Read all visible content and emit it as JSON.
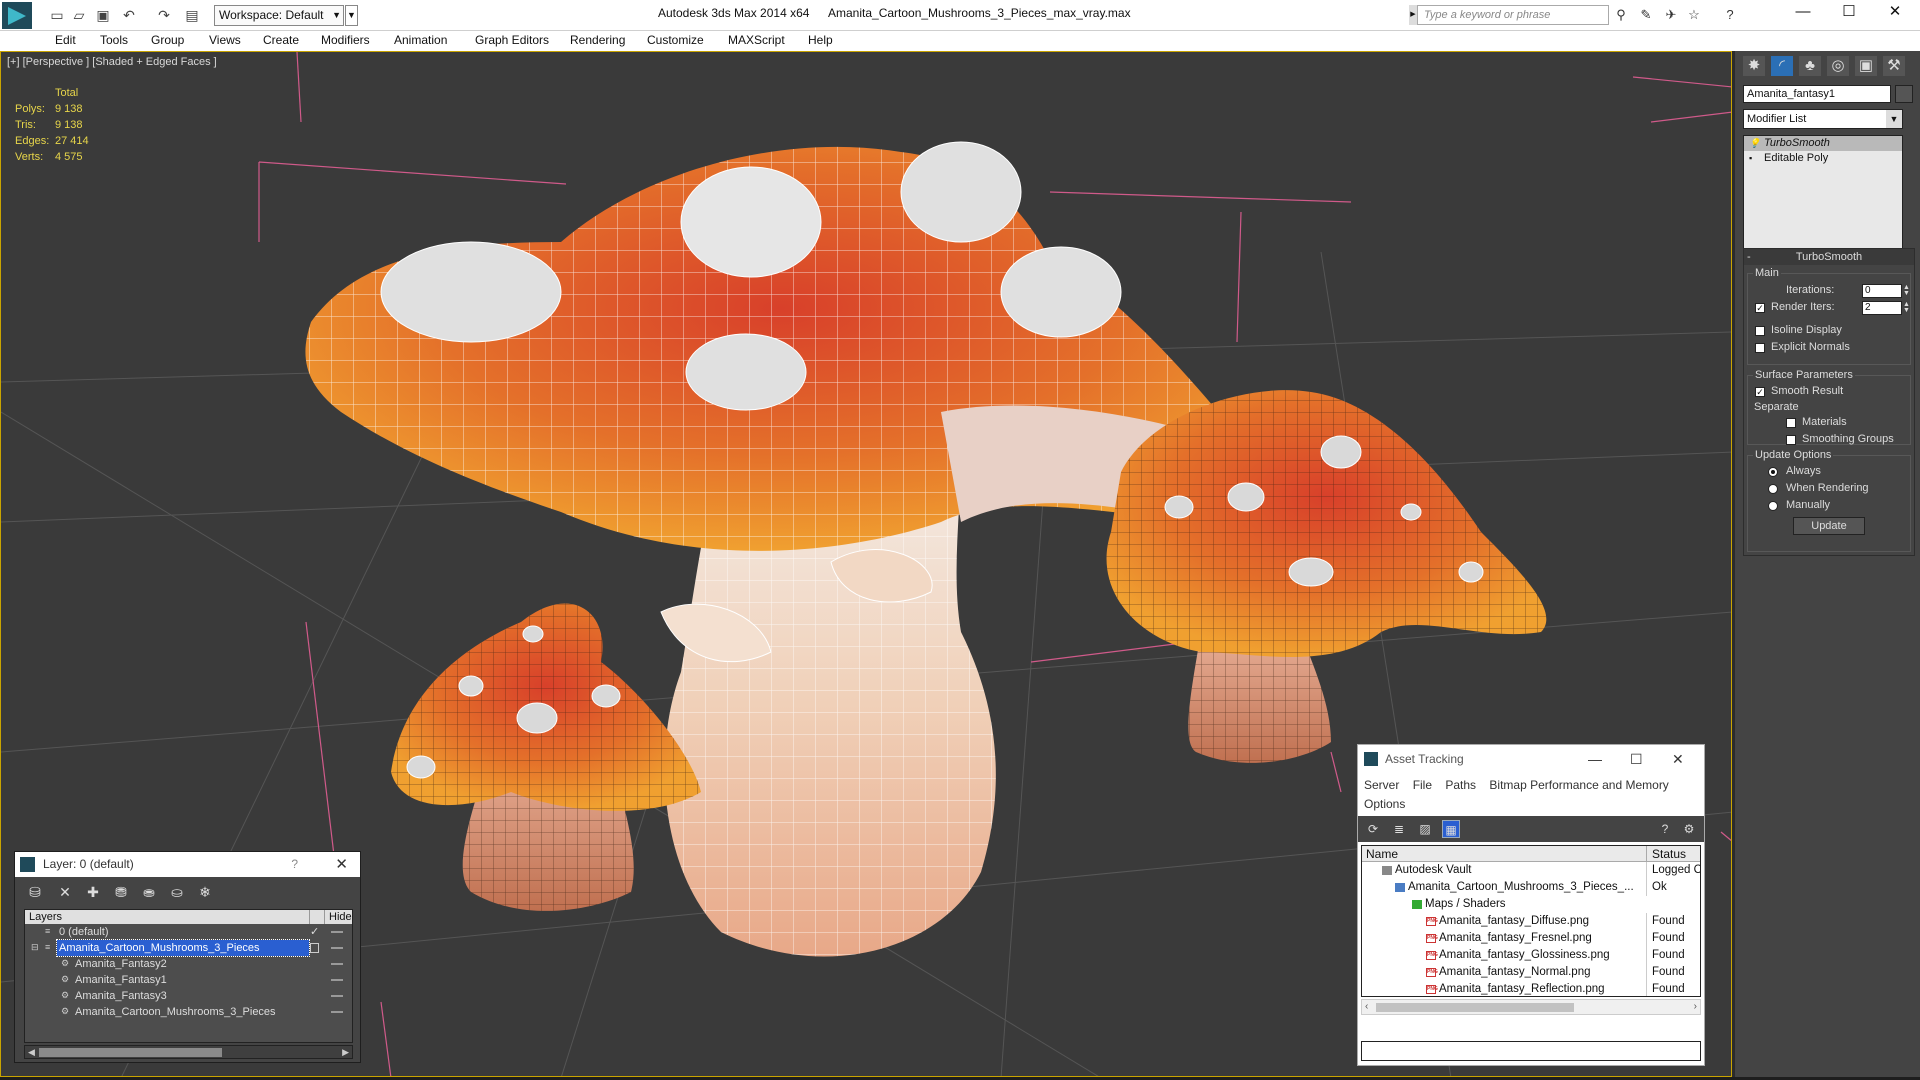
{
  "window": {
    "app_title": "Autodesk 3ds Max  2014 x64",
    "file_title": "Amanita_Cartoon_Mushrooms_3_Pieces_max_vray.max",
    "workspace": "Workspace: Default",
    "search_placeholder": "Type a keyword or phrase",
    "minimize": "—",
    "maximize": "☐",
    "close": "✕"
  },
  "menu": [
    "Edit",
    "Tools",
    "Group",
    "Views",
    "Create",
    "Modifiers",
    "Animation",
    "Graph Editors",
    "Rendering",
    "Customize",
    "MAXScript",
    "Help"
  ],
  "viewport": {
    "label": "[+] [Perspective ] [Shaded + Edged Faces ]",
    "stats": {
      "header": "Total",
      "rows": [
        {
          "k": "Polys:",
          "v": "9 138"
        },
        {
          "k": "Tris:",
          "v": "9 138"
        },
        {
          "k": "Edges:",
          "v": "27 414"
        },
        {
          "k": "Verts:",
          "v": "4 575"
        }
      ]
    }
  },
  "command_panel": {
    "object_name": "Amanita_fantasy1",
    "modifier_list": "Modifier List",
    "stack": [
      "TurboSmooth",
      "Editable Poly"
    ],
    "turbosmooth": {
      "title": "TurboSmooth",
      "main": "Main",
      "iterations_label": "Iterations:",
      "iterations_value": "0",
      "render_iters_label": "Render Iters:",
      "render_iters_value": "2",
      "isoline": "Isoline Display",
      "explicit": "Explicit Normals",
      "surface_params": "Surface Parameters",
      "smooth_result": "Smooth Result",
      "separate": "Separate",
      "materials": "Materials",
      "smoothing_groups": "Smoothing Groups",
      "update_options": "Update Options",
      "always": "Always",
      "when_rendering": "When Rendering",
      "manually": "Manually",
      "update_btn": "Update"
    }
  },
  "layer_window": {
    "title": "Layer: 0 (default)",
    "help": "?",
    "col_layers": "Layers",
    "col_hide": "Hide",
    "rows": [
      "0 (default)",
      "Amanita_Cartoon_Mushrooms_3_Pieces",
      "Amanita_Fantasy2",
      "Amanita_Fantasy1",
      "Amanita_Fantasy3",
      "Amanita_Cartoon_Mushrooms_3_Pieces"
    ]
  },
  "asset_window": {
    "title": "Asset Tracking",
    "menu": [
      "Server",
      "File",
      "Paths",
      "Bitmap Performance and Memory",
      "Options"
    ],
    "col_name": "Name",
    "col_status": "Status",
    "rows": [
      {
        "name": "Autodesk Vault",
        "status": "Logged C"
      },
      {
        "name": "Amanita_Cartoon_Mushrooms_3_Pieces_...",
        "status": "Ok"
      },
      {
        "name": "Maps / Shaders",
        "status": ""
      },
      {
        "name": "Amanita_fantasy_Diffuse.png",
        "status": "Found"
      },
      {
        "name": "Amanita_fantasy_Fresnel.png",
        "status": "Found"
      },
      {
        "name": "Amanita_fantasy_Glossiness.png",
        "status": "Found"
      },
      {
        "name": "Amanita_fantasy_Normal.png",
        "status": "Found"
      },
      {
        "name": "Amanita_fantasy_Reflection.png",
        "status": "Found"
      }
    ]
  }
}
